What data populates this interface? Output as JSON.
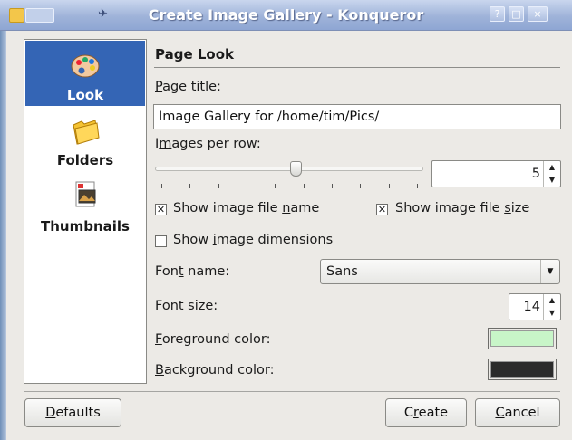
{
  "window": {
    "title": "Create Image Gallery - Konqueror",
    "buttons": [
      "?",
      "□",
      "×"
    ]
  },
  "sidebar": {
    "items": [
      {
        "label": "Look",
        "icon": "palette-icon",
        "selected": true
      },
      {
        "label": "Folders",
        "icon": "folder-icon",
        "selected": false
      },
      {
        "label": "Thumbnails",
        "icon": "thumbnail-image-icon",
        "selected": false
      }
    ]
  },
  "page": {
    "heading": "Page Look",
    "title_label": {
      "pre": "",
      "ul": "P",
      "post": "age title:"
    },
    "title_value": "Image Gallery for /home/tim/Pics/",
    "images_per_row_label": {
      "pre": "I",
      "ul": "m",
      "post": "ages per row:"
    },
    "images_per_row": {
      "value": "5",
      "min": 1,
      "max": 10
    },
    "show_name": {
      "pre": "Show image file ",
      "ul": "n",
      "post": "ame",
      "checked": true
    },
    "show_size": {
      "pre": "Show image file ",
      "ul": "s",
      "post": "ize",
      "checked": true
    },
    "show_dims": {
      "pre": "Show ",
      "ul": "i",
      "post": "mage dimensions",
      "checked": false
    },
    "font_name_label": {
      "pre": "Fon",
      "ul": "t",
      "post": " name:"
    },
    "font_name": "Sans",
    "font_size_label": {
      "pre": "Font si",
      "ul": "z",
      "post": "e:"
    },
    "font_size": "14",
    "foreground_label": {
      "pre": "",
      "ul": "F",
      "post": "oreground color:"
    },
    "foreground_color": "#c8f5c8",
    "background_label": {
      "pre": "",
      "ul": "B",
      "post": "ackground color:"
    },
    "background_color": "#2b2b2b"
  },
  "buttons": {
    "defaults": {
      "pre": "",
      "ul": "D",
      "post": "efaults"
    },
    "create": {
      "pre": "C",
      "ul": "r",
      "post": "eate"
    },
    "cancel": {
      "pre": "",
      "ul": "C",
      "post": "ancel"
    }
  },
  "colors": {
    "selection": "#3465b5",
    "titlebar": "#9fb3d9"
  }
}
